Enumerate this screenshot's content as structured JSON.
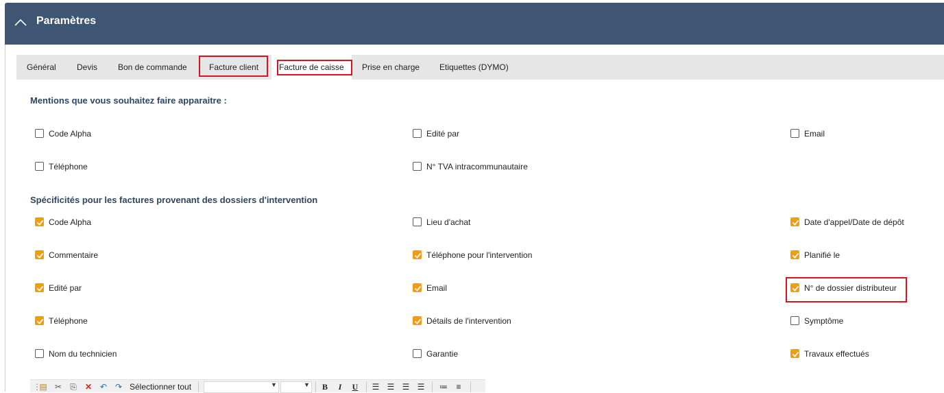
{
  "header": {
    "title": "Paramètres",
    "collapse_icon": "chevron-up-icon"
  },
  "tabs": [
    "Général",
    "Devis",
    "Bon de commande",
    "Facture client",
    "Facture de caisse",
    "Prise en charge",
    "Etiquettes (DYMO)"
  ],
  "active_tab": "Facture de caisse",
  "sections": {
    "mentions": {
      "title": "Mentions que vous souhaitez faire apparaitre :",
      "items": [
        {
          "label": "Code Alpha",
          "checked": false
        },
        {
          "label": "Edité par",
          "checked": false
        },
        {
          "label": "Email",
          "checked": false
        },
        {
          "label": "Téléphone",
          "checked": false
        },
        {
          "label": "N° TVA intracommunautaire",
          "checked": false
        }
      ]
    },
    "specificites": {
      "title": "Spécificités pour les factures provenant des dossiers d'intervention",
      "items": [
        {
          "label": "Code Alpha",
          "checked": true
        },
        {
          "label": "Lieu d'achat",
          "checked": false
        },
        {
          "label": "Date d'appel/Date de dépôt",
          "checked": true
        },
        {
          "label": "Commentaire",
          "checked": true
        },
        {
          "label": "Téléphone pour l'intervention",
          "checked": true
        },
        {
          "label": "Planifié le",
          "checked": true
        },
        {
          "label": "Edité par",
          "checked": true
        },
        {
          "label": "Email",
          "checked": true
        },
        {
          "label": "N° de dossier distributeur",
          "checked": true
        },
        {
          "label": "Téléphone",
          "checked": true
        },
        {
          "label": "Détails de l'intervention",
          "checked": true
        },
        {
          "label": "Symptôme",
          "checked": false
        },
        {
          "label": "Nom du technicien",
          "checked": false
        },
        {
          "label": "Garantie",
          "checked": false
        },
        {
          "label": "Travaux effectués",
          "checked": true
        }
      ]
    }
  },
  "toolbar": {
    "select_all": "Sélectionner tout",
    "bold": "B",
    "italic": "I",
    "underline": "U",
    "icons": [
      "paste-icon",
      "cut-icon",
      "copy-icon",
      "delete-icon",
      "undo-icon",
      "redo-icon",
      "align-left-icon",
      "align-center-icon",
      "align-right-icon",
      "justify-icon",
      "bullet-list-icon",
      "numbered-list-icon"
    ]
  },
  "colors": {
    "header_bg": "#3e5573",
    "checkbox_checked": "#f39c12",
    "section_title": "#2d4663",
    "highlight_border": "#d9121f"
  }
}
